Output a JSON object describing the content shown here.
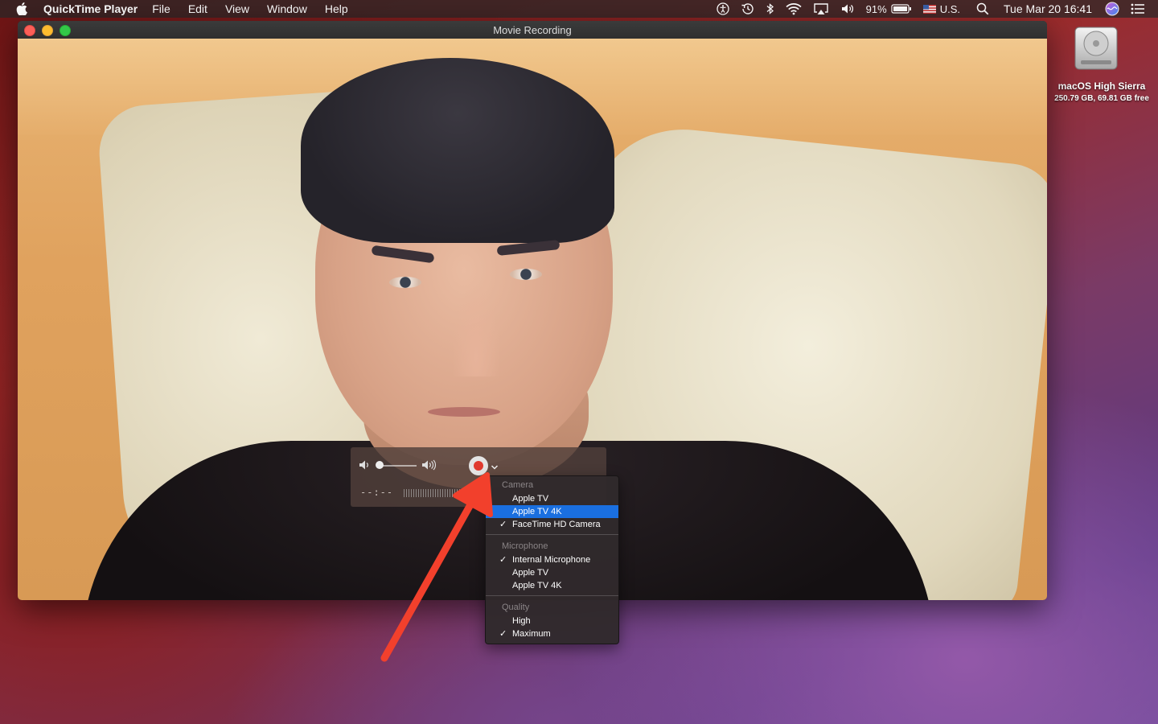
{
  "menubar": {
    "app_name": "QuickTime Player",
    "menus": [
      "File",
      "Edit",
      "View",
      "Window",
      "Help"
    ],
    "battery": "91%",
    "input_source": "U.S.",
    "clock": "Tue Mar 20  16:41"
  },
  "window": {
    "title": "Movie Recording"
  },
  "hud": {
    "time": "--:--",
    "volume_level": 0.0,
    "is_recording": false
  },
  "dropdown": {
    "camera_header": "Camera",
    "camera_items": [
      "Apple TV",
      "Apple TV 4K",
      "FaceTime HD Camera"
    ],
    "camera_selected": "FaceTime HD Camera",
    "camera_highlighted": "Apple TV 4K",
    "microphone_header": "Microphone",
    "microphone_items": [
      "Internal Microphone",
      "Apple TV",
      "Apple TV 4K"
    ],
    "microphone_selected": "Internal Microphone",
    "quality_header": "Quality",
    "quality_items": [
      "High",
      "Maximum"
    ],
    "quality_selected": "Maximum",
    "checkmark": "✓"
  },
  "desktop": {
    "disk_name": "macOS High Sierra",
    "disk_info": "250.79 GB, 69.81 GB free"
  },
  "colors": {
    "menu_highlight": "#1a6fe0",
    "record_red": "#e03a2f",
    "arrow_red": "#f2402c"
  }
}
